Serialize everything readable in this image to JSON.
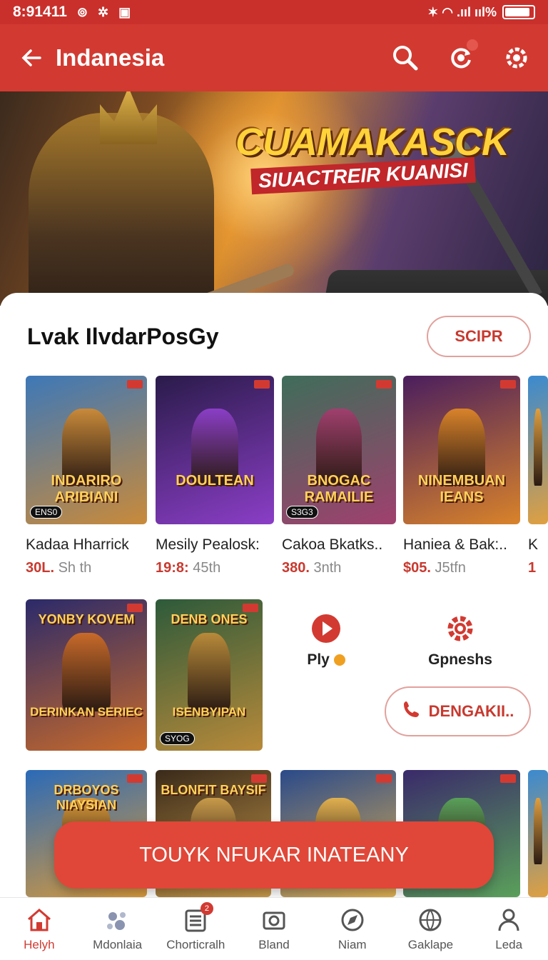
{
  "status_bar": {
    "time": "8:91411",
    "right_text": "✶ ◠ .ııl ııl%"
  },
  "app_bar": {
    "title": "Indanesia"
  },
  "banner": {
    "title": "CUAMAKASCK",
    "subtitle": "SIUACTREIR KUANISI"
  },
  "section": {
    "title": "Lvak IlvdarPosGy",
    "button": "SCIPR"
  },
  "row1": [
    {
      "art_title": "INDARIRO ARIBIANI",
      "badge": "ENS0",
      "name": "Kadaa Hharrick",
      "price": "30L.",
      "meta": "Sh th",
      "colors": [
        "#3d78b8",
        "#c98a3a"
      ]
    },
    {
      "art_title": "DOULTEAN",
      "badge": "",
      "name": "Mesily Pealosk:",
      "price": "19:8:",
      "meta": "45th",
      "colors": [
        "#2a1b4a",
        "#8b3ec7"
      ]
    },
    {
      "art_title": "BNOGAC RAMAILIE",
      "badge": "S3G3",
      "name": "Cakoa Bkatks..",
      "price": "380.",
      "meta": "3nth",
      "colors": [
        "#3f6d5a",
        "#a0406e"
      ]
    },
    {
      "art_title": "NINEMBUAN IEANS",
      "badge": "",
      "name": "Haniea & Bak:..",
      "price": "$05.",
      "meta": "J5tfn",
      "colors": [
        "#4a1e5e",
        "#d9832a"
      ]
    },
    {
      "art_title": "",
      "badge": "",
      "name": "K",
      "price": "1",
      "meta": "",
      "colors": [
        "#3a8ad0",
        "#e0a040"
      ]
    }
  ],
  "row2": [
    {
      "art_title": "YONBY KOVEM",
      "bottom_title": "DERINKAN SERIEC",
      "badge": "",
      "colors": [
        "#2b2a6a",
        "#c86a2a"
      ]
    },
    {
      "art_title": "DENB ONES",
      "bottom_title": "ISENBYIPAN",
      "badge": "SYOG",
      "colors": [
        "#2d5a3a",
        "#b88a3a"
      ]
    }
  ],
  "mini_actions": {
    "play_label": "Ply",
    "settings_label": "Gpneshs"
  },
  "deng_button": "DENGAKII..",
  "row3": [
    {
      "art_title": "DRBOYOS NIAYSIAN",
      "colors": [
        "#2a6ab8",
        "#d99a3a"
      ]
    },
    {
      "art_title": "BLONFIT BAYSIF",
      "colors": [
        "#3a2a1a",
        "#c89a4a"
      ]
    },
    {
      "art_title": "",
      "colors": [
        "#2a4a8a",
        "#e0b050"
      ]
    },
    {
      "art_title": "",
      "colors": [
        "#3a2a6a",
        "#5aa05a"
      ]
    },
    {
      "art_title": "",
      "colors": [
        "#3a8ad0",
        "#e0a040"
      ]
    }
  ],
  "cta": "TOUYK NFUKAR INATEANY",
  "nav": [
    {
      "label": "Helyh",
      "icon": "home-icon"
    },
    {
      "label": "Mdonlaia",
      "icon": "bubbles-icon"
    },
    {
      "label": "Chorticralh",
      "icon": "calendar-list-icon",
      "badge": "2"
    },
    {
      "label": "Bland",
      "icon": "camera-icon"
    },
    {
      "label": "Niam",
      "icon": "compass-icon"
    },
    {
      "label": "Gaklape",
      "icon": "globe-icon"
    },
    {
      "label": "Leda",
      "icon": "profile-icon"
    }
  ],
  "colors": {
    "primary": "#d23a31",
    "accent": "#c8392f"
  }
}
